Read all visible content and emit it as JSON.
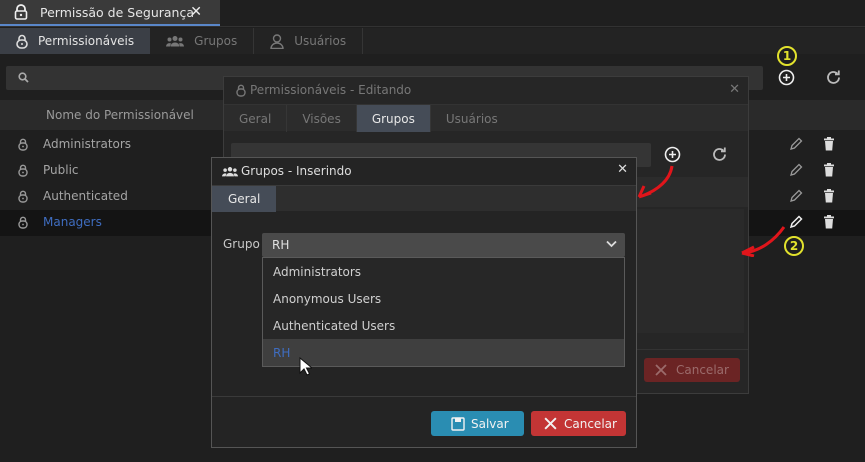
{
  "window": {
    "tab_title": "Permissão de Segurança",
    "close": "✕"
  },
  "main_tabs": [
    {
      "label": "Permissionáveis",
      "icon": "lock-icon",
      "active": true
    },
    {
      "label": "Grupos",
      "icon": "users-icon",
      "active": false
    },
    {
      "label": "Usuários",
      "icon": "user-icon",
      "active": false
    }
  ],
  "list": {
    "column_header": "Nome do Permissionável",
    "rows": [
      {
        "name": "Administrators"
      },
      {
        "name": "Public"
      },
      {
        "name": "Authenticated"
      },
      {
        "name": "Managers",
        "selected": true
      }
    ]
  },
  "annotations": {
    "badge1": "1",
    "badge2": "2",
    "arrow_color": "#e0151b",
    "badge_color": "#e2e22d"
  },
  "edit_dialog": {
    "title": "Permissionáveis - Editando",
    "close": "✕",
    "tabs": [
      {
        "label": "Geral"
      },
      {
        "label": "Visões"
      },
      {
        "label": "Grupos",
        "active": true
      },
      {
        "label": "Usuários"
      }
    ],
    "cancel_label": "Cancelar"
  },
  "insert_dialog": {
    "title": "Grupos - Inserindo",
    "close": "✕",
    "tab": "Geral",
    "field_label": "Grupo",
    "selected_value": "RH",
    "options": [
      "Administrators",
      "Anonymous Users",
      "Authenticated Users",
      "RH"
    ],
    "save_label": "Salvar",
    "cancel_label": "Cancelar"
  },
  "colors": {
    "accent": "#3f6dc0",
    "save": "#2a8db2",
    "cancel": "#c33535"
  }
}
